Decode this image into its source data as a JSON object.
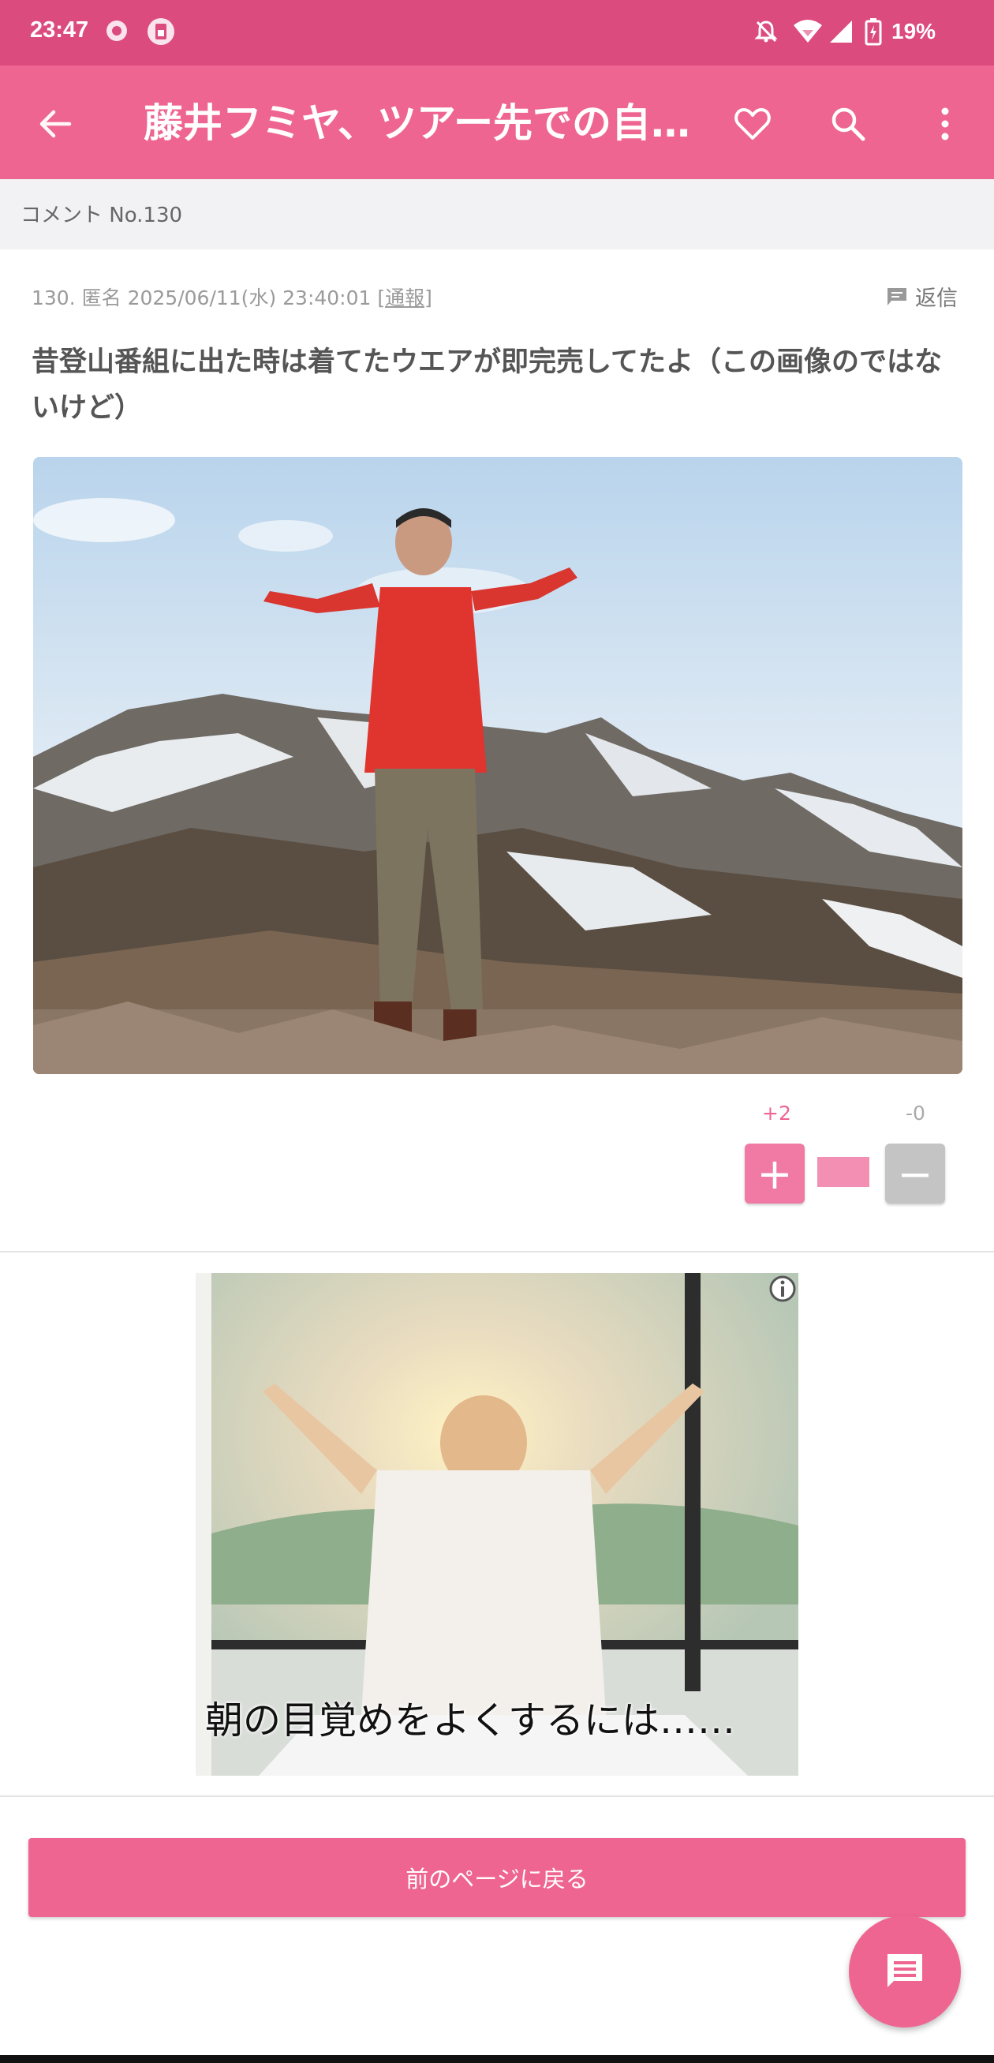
{
  "status_bar": {
    "time": "23:47",
    "battery": "19%",
    "icons": [
      "app-icon",
      "sim-icon",
      "bell-off-icon",
      "wifi-icon",
      "signal-icon",
      "battery-icon"
    ]
  },
  "app_bar": {
    "title": "藤井フミヤ、ツアー先での自…",
    "icons": [
      "back-arrow-icon",
      "heart-icon",
      "search-icon",
      "more-vert-icon"
    ]
  },
  "breadcrumb": {
    "label": "コメント No.130"
  },
  "comment": {
    "number": "130.",
    "author": "匿名",
    "date": "2025/06/11(水) 23:40:01",
    "report_label": "[通報]",
    "reply_label": "返信",
    "text": "昔登山番組に出た時は着てたウエアが即完売してたよ（この画像のではないけど）",
    "plus_count": "+2",
    "minus_count": "-0",
    "plus_label": "+",
    "minus_label": "−",
    "vote_ratio_plus": 1.0
  },
  "ad": {
    "caption": "朝の目覚めをよくするには……",
    "info_icon": "info-icon"
  },
  "back_button": {
    "label": "前のページに戻る"
  },
  "fab": {
    "icon": "comment-icon"
  },
  "colors": {
    "status_bar": "#dc4b7e",
    "app_bar": "#ef6592",
    "accent": "#ef6592",
    "minus_button": "#c4c4c4"
  }
}
